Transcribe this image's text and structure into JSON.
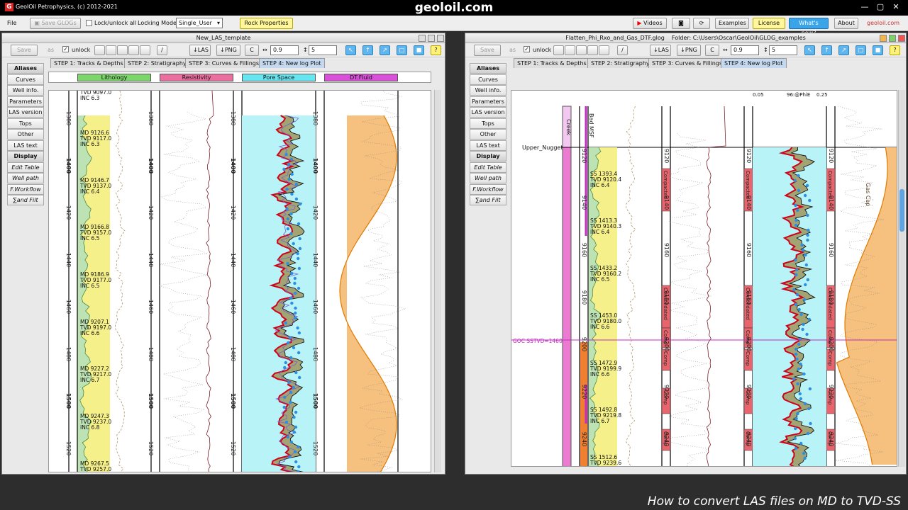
{
  "app": {
    "title": "GeolOil Petrophysics, (c) 2012-2021",
    "logo_letter": "G",
    "brand": "geoloil.com",
    "caption": "How to convert LAS files on MD to TVD-SS"
  },
  "menubar": {
    "file": "File",
    "save_glogs": "Save GLOGs",
    "lock_unlock_all": "Lock/unlock all",
    "locking_mode_label": "Locking Mode:",
    "locking_mode_value": "Single_User",
    "rock_properties": "Rock Properties",
    "videos": "Videos",
    "examples": "Examples",
    "license": "License",
    "whats_new": "What's new?",
    "about": "About",
    "brand_small": "geoloil.com"
  },
  "left_window": {
    "title": "New_LAS_template",
    "toolbar": {
      "save": "Save",
      "as": "as",
      "unlock": "unlock",
      "las": "↓LAS",
      "png": "↓PNG",
      "c": "C",
      "ratio": "0.9",
      "count": "5",
      "help": "?"
    },
    "tabs": [
      "STEP 1: Tracks & Depths",
      "STEP 2: Stratigraphy",
      "STEP 3: Curves & Fillings",
      "STEP 4: New log Plot"
    ],
    "sidebar": [
      "Aliases",
      "Curves",
      "Well info.",
      "Parameters",
      "LAS version",
      "Tops",
      "Other",
      "LAS text",
      "Display",
      "Edit Table",
      "Well path",
      "F.Workflow",
      "∑and Filt"
    ],
    "track_headers": [
      "Lithology",
      "Resistivity",
      "Pore Space",
      "DT.Fluid"
    ],
    "depths": [
      "1380",
      "1400",
      "1420",
      "1440",
      "1460",
      "1480",
      "1500",
      "1520"
    ],
    "annotations": [
      "TVD 9097.0\nINC 6.3",
      "MD 9126.6\nTVD 9117.0\nINC 6.3",
      "MD 9146.7\nTVD 9137.0\nINC 6.4",
      "MD 9166.8\nTVD 9157.0\nINC 6.5",
      "MD 9186.9\nTVD 9177.0\nINC 6.5",
      "MD 9207.1\nTVD 9197.0\nINC 6.6",
      "MD 9227.2\nTVD 9217.0\nINC 6.7",
      "MD 9247.3\nTVD 9237.0\nINC 6.8",
      "MD 9267.5\nTVD 9257.0"
    ]
  },
  "right_window": {
    "title": "Flatten_Phi_Rxo_and_Gas_DTF.glog",
    "folder": "Folder: C:\\Users\\Oscar\\GeolOil\\GLOG_examples",
    "toolbar": {
      "save": "Save",
      "as": "as",
      "unlock": "unlock",
      "las": "↓LAS",
      "png": "↓PNG",
      "c": "C",
      "ratio": "0.9",
      "count": "5",
      "help": "?"
    },
    "tabs": [
      "STEP 1: Tracks & Depths",
      "STEP 2: Stratigraphy",
      "STEP 3: Curves & Fillings",
      "STEP 4: New log Plot"
    ],
    "sidebar": [
      "Aliases",
      "Curves",
      "Well info.",
      "Parameters",
      "LAS version",
      "Tops",
      "Other",
      "LAS text",
      "Display",
      "Edit Table",
      "Well path",
      "F.Workflow",
      "∑and Filt"
    ],
    "scale": {
      "min": "0.05",
      "curve": "96:@PhiE",
      "max": "0.25"
    },
    "top_marker": "Upper_Nugget",
    "goc_label": "GOC SSTVD=1460",
    "formation": "Creek",
    "gas_cap": "Gas Cap",
    "bad_msf": "Bad MSF",
    "depths": [
      "9120",
      "9140",
      "9160",
      "9180",
      "9200",
      "9220",
      "9240"
    ],
    "annotations": [
      "SS 1393.4\nTVD 9120.4\nINC 6.4",
      "SS 1413.3\nTVD 9140.3\nINC 6.4",
      "SS 1433.2\nTVD 9160.2\nINC 6.5",
      "SS 1453.0\nTVD 9180.0\nINC 6.6",
      "SS 1472.9\nTVD 9199.9\nINC 6.6",
      "SS 1492.8\nTVD 9219.8\nINC 6.7",
      "SS 1512.6\nTVD 9239.6"
    ],
    "lith_labels": [
      "Compacted",
      "Consolidated",
      "Comp",
      "Comp",
      "Comp",
      "Comp"
    ]
  },
  "colors": {
    "lith": "#7dd66b",
    "resist": "#ea6ea0",
    "pore": "#66e6f0",
    "dtfluid": "#d84fd8",
    "yellow": "#f5f08a",
    "green": "#bde3b4",
    "cyan": "#b8f3f7",
    "orange": "#f6c07e",
    "olive": "#9c9151",
    "red": "#d0021b",
    "magenta": "#c42ac4"
  }
}
